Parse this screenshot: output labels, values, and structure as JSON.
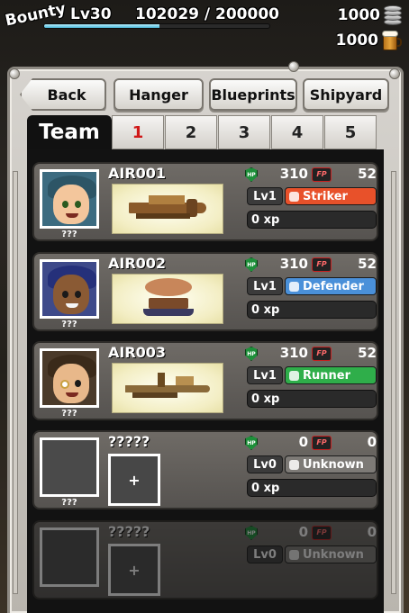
{
  "hud": {
    "bounty_label": "Bounty",
    "level": "Lv30",
    "xp": "102029 / 200000",
    "xp_progress": 0.51,
    "silver": "1000",
    "beer": "1000"
  },
  "nav": {
    "back": "Back",
    "hanger": "Hanger",
    "blueprints": "Blueprints",
    "shipyard": "Shipyard"
  },
  "team": {
    "label": "Team",
    "tabs": [
      "1",
      "2",
      "3",
      "4",
      "5"
    ],
    "active_tab": "1"
  },
  "ships": [
    {
      "name": "AIR001",
      "pilot": "???",
      "hp": "310",
      "fp": "52",
      "level": "Lv1",
      "class": "Striker",
      "class_color": "#e8512a",
      "xp": "0 xp"
    },
    {
      "name": "AIR002",
      "pilot": "???",
      "hp": "310",
      "fp": "52",
      "level": "Lv1",
      "class": "Defender",
      "class_color": "#4a90d9",
      "xp": "0 xp"
    },
    {
      "name": "AIR003",
      "pilot": "???",
      "hp": "310",
      "fp": "52",
      "level": "Lv1",
      "class": "Runner",
      "class_color": "#2fae4a",
      "xp": "0 xp"
    },
    {
      "name": "?????",
      "pilot": "???",
      "hp": "0",
      "fp": "0",
      "level": "Lv0",
      "class": "Unknown",
      "class_color": "#7d7a76",
      "xp": "0 xp",
      "add": "+"
    },
    {
      "name": "?????",
      "pilot": "",
      "hp": "0",
      "fp": "0",
      "level": "Lv0",
      "class": "Unknown",
      "class_color": "#7d7a76",
      "xp": "",
      "add": "+"
    }
  ],
  "icons": {
    "hp": "HP",
    "fp": "FP"
  }
}
